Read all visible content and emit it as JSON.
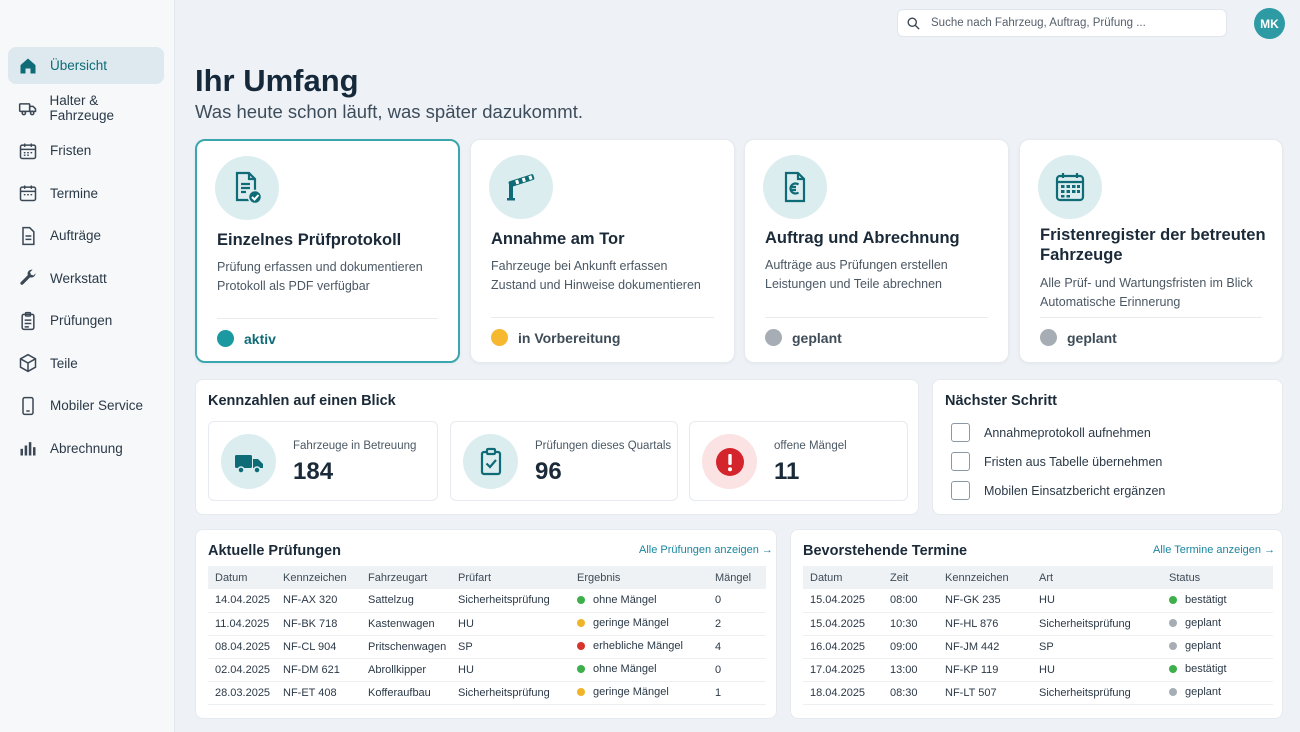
{
  "colors": {
    "accent": "#0f6b76",
    "active": "#1a9aa0",
    "prep": "#f5b82e",
    "planned": "#a6adb4",
    "ok": "#3db04b",
    "warn": "#f0b429",
    "bad": "#d9342b"
  },
  "search": {
    "placeholder": "Suche nach Fahrzeug, Auftrag, Prüfung ..."
  },
  "user": {
    "initials": "MK"
  },
  "sidebar": {
    "items": [
      {
        "label": "Übersicht",
        "icon": "home-icon"
      },
      {
        "label": "Halter & Fahrzeuge",
        "icon": "truck-icon"
      },
      {
        "label": "Fristen",
        "icon": "calendar-icon"
      },
      {
        "label": "Termine",
        "icon": "calendar-icon"
      },
      {
        "label": "Aufträge",
        "icon": "document-icon"
      },
      {
        "label": "Werkstatt",
        "icon": "wrench-icon"
      },
      {
        "label": "Prüfungen",
        "icon": "clipboard-icon"
      },
      {
        "label": "Teile",
        "icon": "box-icon"
      },
      {
        "label": "Mobiler Service",
        "icon": "phone-icon"
      },
      {
        "label": "Abrechnung",
        "icon": "bar-chart-icon"
      }
    ]
  },
  "header": {
    "title": "Ihr Umfang",
    "subtitle": "Was heute schon läuft, was später dazukommt."
  },
  "modules": [
    {
      "title": "Einzelnes Prüfprotokoll",
      "line1": "Prüfung erfassen und dokumentieren",
      "line2": "Protokoll als PDF verfügbar",
      "status": "aktiv",
      "icon": "protocol-check-icon"
    },
    {
      "title": "Annahme am Tor",
      "line1": "Fahrzeuge bei Ankunft erfassen",
      "line2": "Zustand und Hinweise dokumentieren",
      "status": "in Vorbereitung",
      "icon": "barrier-gate-icon"
    },
    {
      "title": "Auftrag und Abrechnung",
      "line1": "Aufträge aus Prüfungen erstellen",
      "line2": "Leistungen und Teile abrechnen",
      "status": "geplant",
      "icon": "invoice-euro-icon"
    },
    {
      "title": "Fristenregister der betreuten Fahrzeuge",
      "line1": "Alle Prüf- und Wartungsfristen im Blick",
      "line2": "Automatische Erinnerung",
      "status": "geplant",
      "icon": "calendar-icon"
    }
  ],
  "kpis": {
    "title": "Kennzahlen auf einen Blick",
    "items": [
      {
        "label": "Fahrzeuge in Betreuung",
        "value": "184",
        "icon": "truck-icon"
      },
      {
        "label": "Prüfungen dieses Quartals",
        "value": "96",
        "icon": "clipboard-check-icon"
      },
      {
        "label": "offene Mängel",
        "value": "11",
        "icon": "alert-icon"
      }
    ]
  },
  "next": {
    "title": "Nächster Schritt",
    "items": [
      "Annahmeprotokoll aufnehmen",
      "Fristen aus Tabelle übernehmen",
      "Mobilen Einsatzbericht ergänzen"
    ]
  },
  "inspections": {
    "title": "Aktuelle Prüfungen",
    "link": "Alle Prüfungen anzeigen →",
    "columns": [
      "Datum",
      "Kennzeichen",
      "Fahrzeugart",
      "Prüfart",
      "Ergebnis",
      "Mängel"
    ],
    "rows": [
      {
        "datum": "14.04.2025",
        "kz": "NF-AX 320",
        "art": "Sattelzug",
        "pruefart": "Sicherheitsprüfung",
        "ergebnis": "ohne Mängel",
        "level": "ok",
        "maengel": "0"
      },
      {
        "datum": "11.04.2025",
        "kz": "NF-BK 718",
        "art": "Kastenwagen",
        "pruefart": "HU",
        "ergebnis": "geringe Mängel",
        "level": "warn",
        "maengel": "2"
      },
      {
        "datum": "08.04.2025",
        "kz": "NF-CL 904",
        "art": "Pritschenwagen",
        "pruefart": "SP",
        "ergebnis": "erhebliche Mängel",
        "level": "bad",
        "maengel": "4"
      },
      {
        "datum": "02.04.2025",
        "kz": "NF-DM 621",
        "art": "Abrollkipper",
        "pruefart": "HU",
        "ergebnis": "ohne Mängel",
        "level": "ok",
        "maengel": "0"
      },
      {
        "datum": "28.03.2025",
        "kz": "NF-ET 408",
        "art": "Kofferaufbau",
        "pruefart": "Sicherheitsprüfung",
        "ergebnis": "geringe Mängel",
        "level": "warn",
        "maengel": "1"
      }
    ]
  },
  "appointments": {
    "title": "Bevorstehende Termine",
    "link": "Alle Termine anzeigen →",
    "columns": [
      "Datum",
      "Zeit",
      "Kennzeichen",
      "Art",
      "Status"
    ],
    "rows": [
      {
        "datum": "15.04.2025",
        "zeit": "08:00",
        "kz": "NF-GK 235",
        "art": "HU",
        "status": "bestätigt",
        "level": "ok"
      },
      {
        "datum": "15.04.2025",
        "zeit": "10:30",
        "kz": "NF-HL 876",
        "art": "Sicherheitsprüfung",
        "status": "geplant",
        "level": "planned"
      },
      {
        "datum": "16.04.2025",
        "zeit": "09:00",
        "kz": "NF-JM 442",
        "art": "SP",
        "status": "geplant",
        "level": "planned"
      },
      {
        "datum": "17.04.2025",
        "zeit": "13:00",
        "kz": "NF-KP 119",
        "art": "HU",
        "status": "bestätigt",
        "level": "ok"
      },
      {
        "datum": "18.04.2025",
        "zeit": "08:30",
        "kz": "NF-LT 507",
        "art": "Sicherheitsprüfung",
        "status": "geplant",
        "level": "planned"
      }
    ]
  }
}
